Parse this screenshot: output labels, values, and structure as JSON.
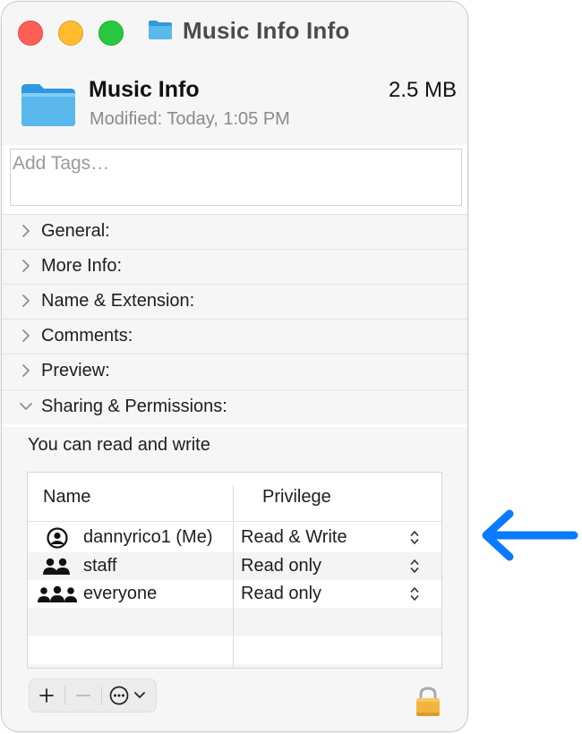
{
  "window": {
    "title": "Music Info Info"
  },
  "header": {
    "file_name": "Music Info",
    "file_size": "2.5 MB",
    "modified": "Modified:  Today, 1:05 PM"
  },
  "tags": {
    "placeholder": "Add Tags…"
  },
  "sections": [
    {
      "label": "General:",
      "expanded": false
    },
    {
      "label": "More Info:",
      "expanded": false
    },
    {
      "label": "Name & Extension:",
      "expanded": false
    },
    {
      "label": "Comments:",
      "expanded": false
    },
    {
      "label": "Preview:",
      "expanded": false
    },
    {
      "label": "Sharing & Permissions:",
      "expanded": true
    }
  ],
  "permissions": {
    "note": "You can read and write",
    "columns": {
      "name": "Name",
      "privilege": "Privilege"
    },
    "rows": [
      {
        "name": "dannyrico1 (Me)",
        "privilege": "Read & Write",
        "icon": "person-circle-icon"
      },
      {
        "name": "staff",
        "privilege": "Read only",
        "icon": "two-people-icon"
      },
      {
        "name": "everyone",
        "privilege": "Read only",
        "icon": "three-people-icon"
      }
    ]
  },
  "toolbar": {
    "add_label": "+",
    "remove_label": "—"
  },
  "colors": {
    "arrow": "#0a7aff",
    "folder": "#5ab8ec",
    "close": "#fe5f57",
    "minimize": "#febc2e",
    "maximize": "#28c840",
    "lock": "#f2b441"
  }
}
